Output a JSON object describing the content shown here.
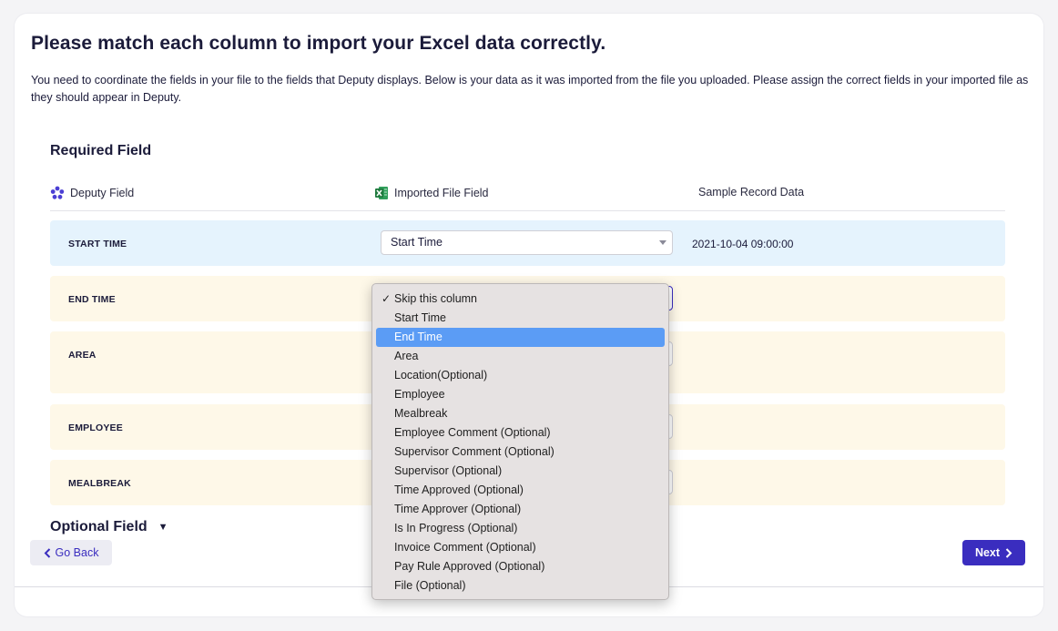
{
  "page": {
    "title": "Please match each column to import your Excel data correctly.",
    "intro": "You need to coordinate the fields in your file to the fields that Deputy displays. Below is your data as it was imported from the file you uploaded. Please assign the correct fields in your imported file as they should appear in Deputy."
  },
  "required_section": {
    "title": "Required Field",
    "columns": {
      "deputy": "Deputy Field",
      "imported": "Imported File Field",
      "sample": "Sample Record Data"
    },
    "rows": [
      {
        "label": "START TIME",
        "selected": "Start Time",
        "sample": "2021-10-04 09:00:00"
      },
      {
        "label": "END TIME",
        "selected": "",
        "sample": ""
      },
      {
        "label": "AREA",
        "selected": "",
        "sample": ""
      },
      {
        "label": "EMPLOYEE",
        "selected": "",
        "sample": ""
      },
      {
        "label": "MEALBREAK",
        "selected": "",
        "sample": ""
      }
    ]
  },
  "optional_section": {
    "title": "Optional Field",
    "toggle_icon": "triangle-down-icon"
  },
  "buttons": {
    "back": "Go Back",
    "next": "Next"
  },
  "dropdown": {
    "checked_index": 0,
    "highlighted_index": 2,
    "options": [
      "Skip this column",
      "Start Time",
      "End Time",
      "Area",
      "Location(Optional)",
      "Employee",
      "Mealbreak",
      "Employee Comment (Optional)",
      "Supervisor Comment (Optional)",
      "Supervisor (Optional)",
      "Time Approved (Optional)",
      "Time Approver (Optional)",
      "Is In Progress (Optional)",
      "Invoice Comment (Optional)",
      "Pay Rule Approved (Optional)",
      "File (Optional)"
    ]
  },
  "colors": {
    "accent": "#3a2dbf",
    "row_blue": "#e5f3fd",
    "row_cream": "#fef8e8",
    "highlight": "#5b9cf5",
    "excel_green": "#1f7a3e"
  }
}
